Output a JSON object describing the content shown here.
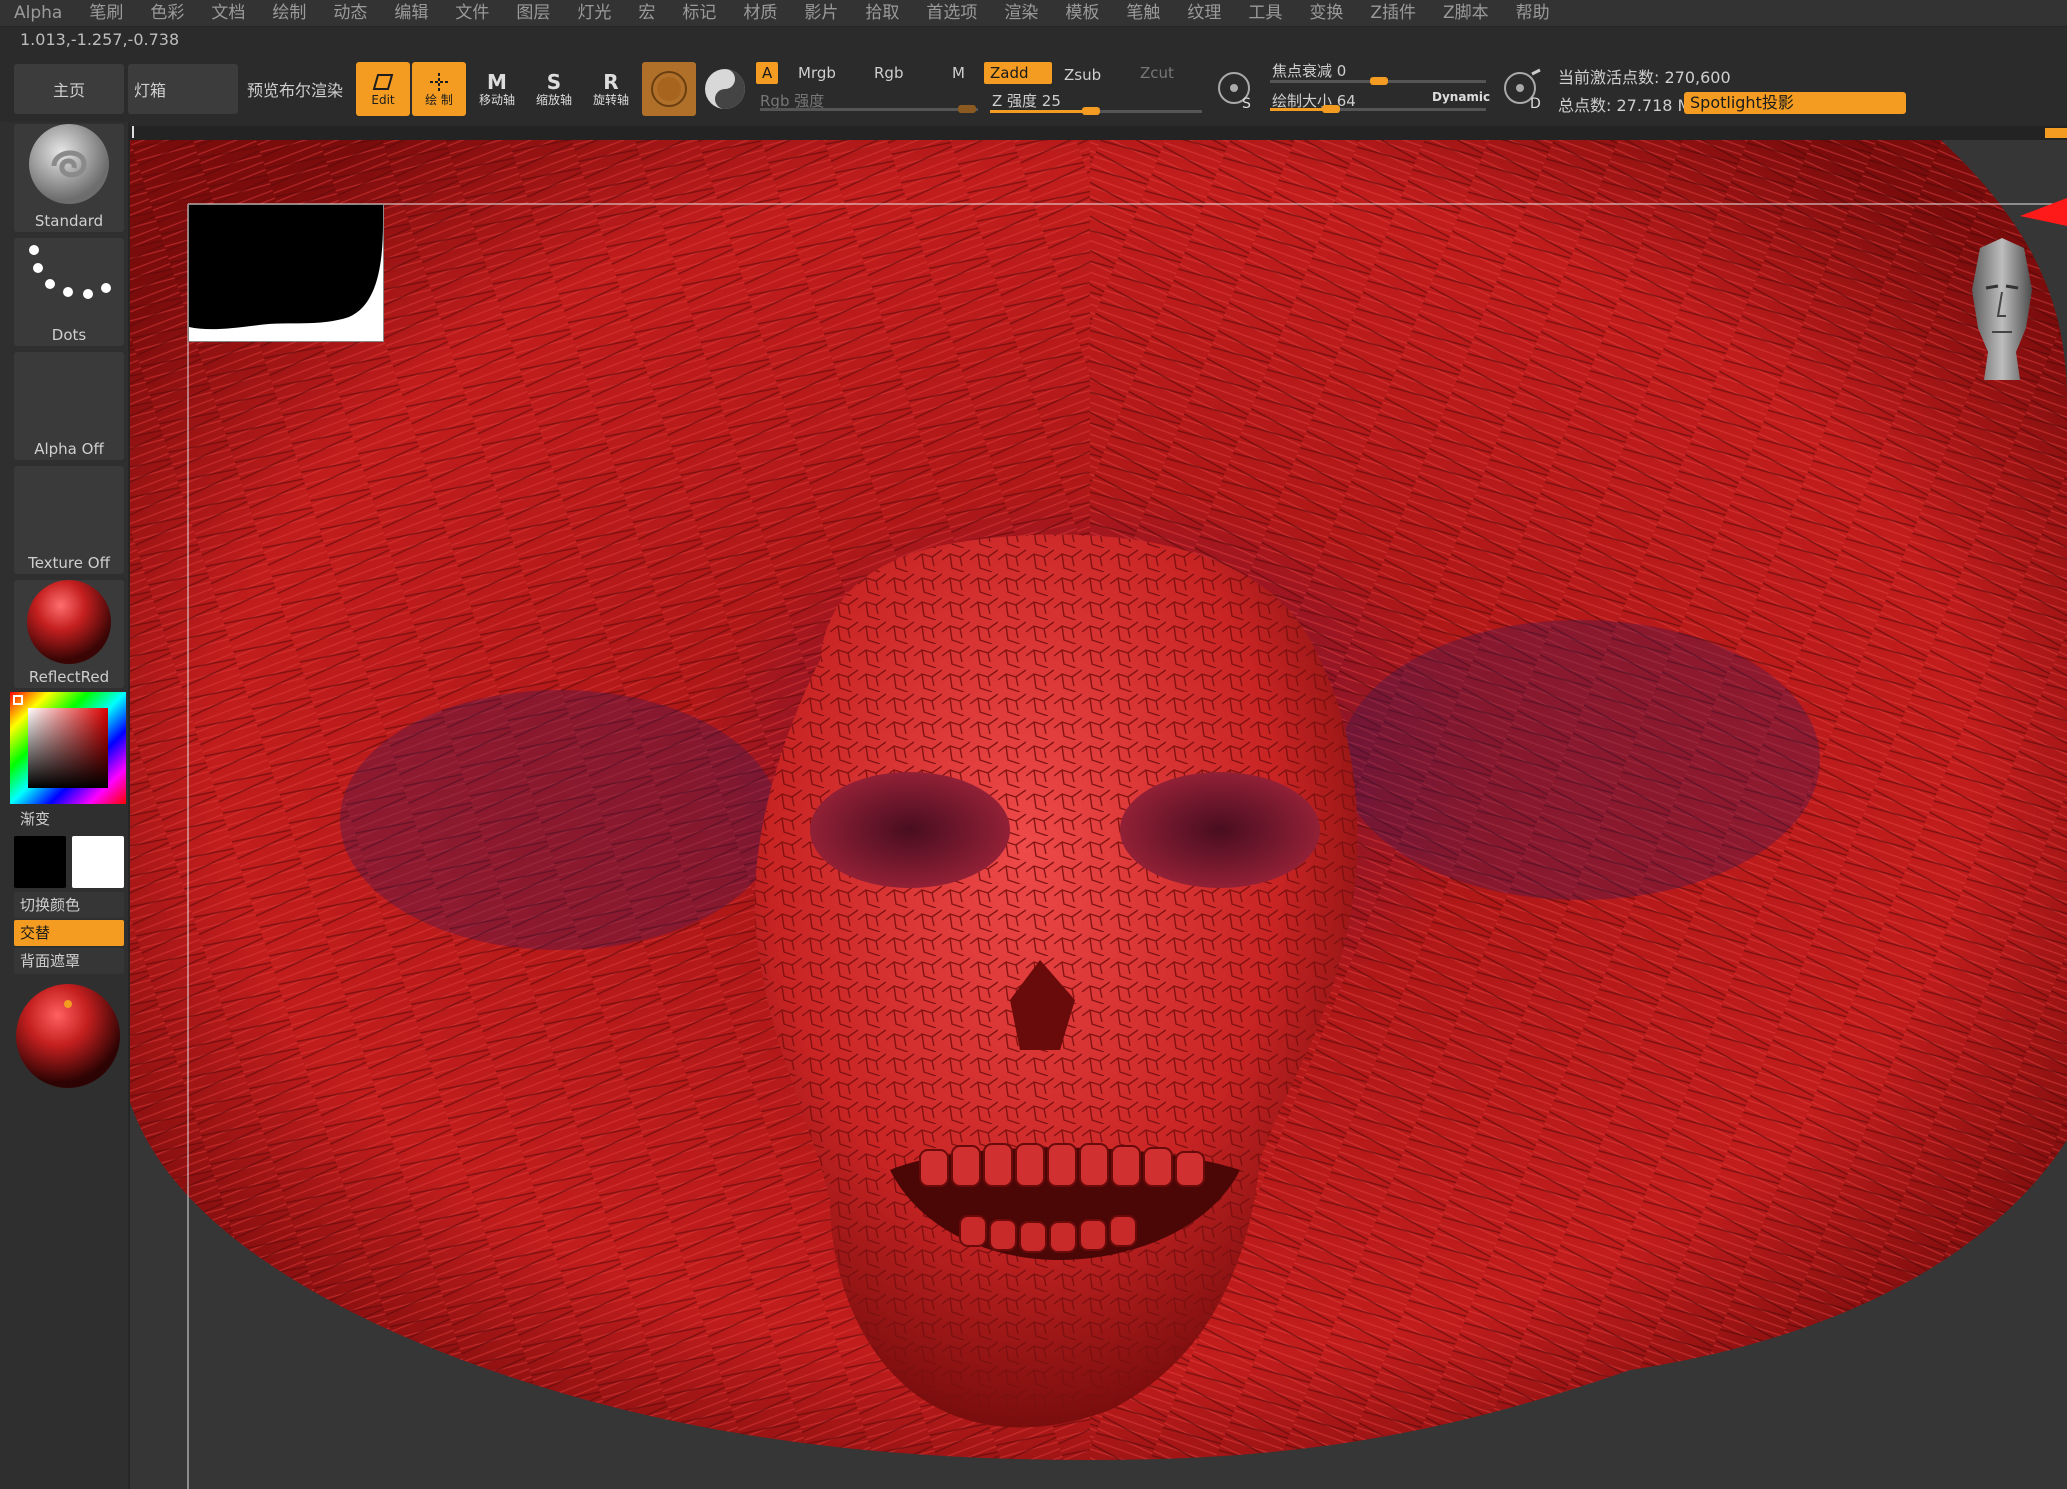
{
  "menu": [
    "Alpha",
    "笔刷",
    "色彩",
    "文档",
    "绘制",
    "动态",
    "编辑",
    "文件",
    "图层",
    "灯光",
    "宏",
    "标记",
    "材质",
    "影片",
    "拾取",
    "首选项",
    "渲染",
    "模板",
    "笔触",
    "纹理",
    "工具",
    "变换",
    "Z插件",
    "Z脚本",
    "帮助"
  ],
  "coords": "1.013,-1.257,-0.738",
  "shelf": {
    "home_label": "主页",
    "lightbox_label": "灯箱",
    "bpr_label": "预览布尔渲染",
    "edit_label": "Edit",
    "draw_label": "绘 制",
    "move_label": "移动轴",
    "scale_label": "缩放轴",
    "rotate_label": "旋转轴",
    "a_label": "A",
    "mrgb_label": "Mrgb",
    "rgb_label": "Rgb",
    "m_label": "M",
    "zadd_label": "Zadd",
    "zsub_label": "Zsub",
    "zcut_label": "Zcut",
    "rgb_intensity_label": "Rgb 强度",
    "z_intensity_label": "Z 强度 25",
    "z_intensity_value": 25,
    "focal_shift_label": "焦点衰减 0",
    "focal_shift_value": 0,
    "draw_size_label": "绘制大小 64",
    "draw_size_value": 64,
    "dynamic_label": "Dynamic",
    "active_points_label": "当前激活点数: 270,600",
    "total_points_label": "总点数: 27.718 Mil",
    "spotlight_label": "Spotlight投影"
  },
  "tray": {
    "brush_label": "Standard",
    "stroke_label": "Dots",
    "alpha_label": "Alpha Off",
    "texture_label": "Texture Off",
    "material_label": "ReflectRed",
    "gradient_label": "渐变",
    "switch_color_label": "切换颜色",
    "alternate_label": "交替",
    "backface_label": "背面遮罩"
  },
  "colors": {
    "accent": "#f39c21",
    "flesh": "#c41f1f",
    "flesh_dark": "#6b0b0b",
    "hair_shadow": "#3a1a55"
  }
}
